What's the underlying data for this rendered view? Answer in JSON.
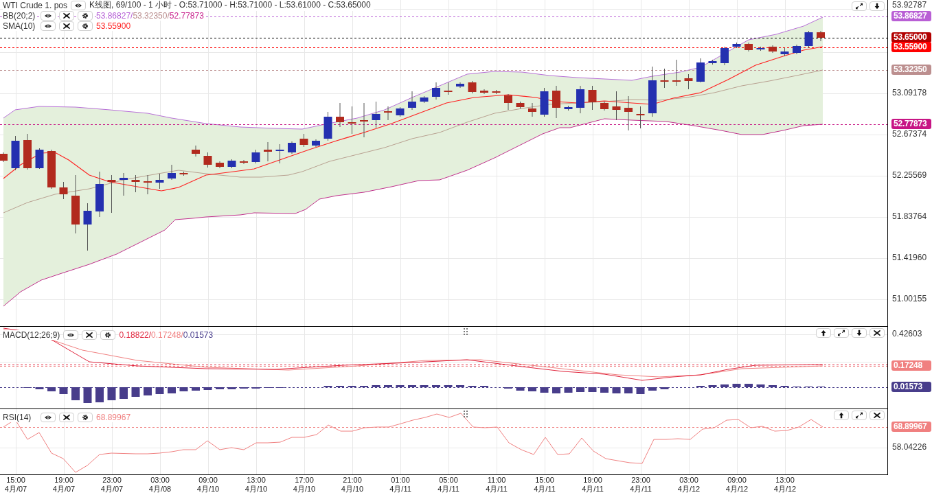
{
  "main_panel": {
    "title": "WTI Crude 1. pos",
    "summary": "K线图, 69/100 - 1 小时 - O:53.71000 - H:53.71000 - L:53.61000 - C:53.65000",
    "indicators": [
      {
        "name": "BB(20;2)",
        "values": [
          {
            "text": "53.86827/",
            "color": "#b660d6"
          },
          {
            "text": "53.32350/",
            "color": "#b88c8c"
          },
          {
            "text": "52.77873",
            "color": "#c8208c"
          }
        ]
      },
      {
        "name": "SMA(10)",
        "values": [
          {
            "text": "53.55900",
            "color": "#ff2222"
          }
        ]
      }
    ],
    "axis_labels": [
      "53.92787",
      "53.09178",
      "52.67374",
      "52.25569",
      "51.83764",
      "51.41960",
      "51.00155"
    ],
    "price_tags": [
      {
        "text": "53.86827",
        "color": "#b95fd5"
      },
      {
        "text": "53.65000",
        "color": "#b20000"
      },
      {
        "text": "53.55900",
        "color": "#ff0000"
      },
      {
        "text": "53.32350",
        "color": "#bc8f8f"
      },
      {
        "text": "52.77873",
        "color": "#c71585"
      }
    ]
  },
  "macd_panel": {
    "indicators": [
      {
        "name": "MACD(12;26;9)",
        "values": [
          {
            "text": "0.18822/",
            "color": "#e0243c"
          },
          {
            "text": "0.17248/",
            "color": "#f08080"
          },
          {
            "text": "0.01573",
            "color": "#483d8b"
          }
        ]
      }
    ],
    "axis_labels": [
      "0.42603"
    ],
    "price_tags": [
      {
        "text": "0.17248",
        "color": "#f08080"
      },
      {
        "text": "0.01573",
        "color": "#483d8b"
      }
    ]
  },
  "rsi_panel": {
    "indicators": [
      {
        "name": "RSI(14)",
        "values": [
          {
            "text": "68.89967",
            "color": "#f08080"
          }
        ]
      }
    ],
    "axis_labels": [
      "58.04226"
    ],
    "price_tags": [
      {
        "text": "68.89967",
        "color": "#f08080"
      }
    ]
  },
  "time_axis": [
    {
      "time": "15:00",
      "date": "4月/07"
    },
    {
      "time": "19:00",
      "date": "4月/07"
    },
    {
      "time": "23:00",
      "date": "4月/07"
    },
    {
      "time": "03:00",
      "date": "4月/08"
    },
    {
      "time": "09:00",
      "date": "4月/10"
    },
    {
      "time": "13:00",
      "date": "4月/10"
    },
    {
      "time": "17:00",
      "date": "4月/10"
    },
    {
      "time": "21:00",
      "date": "4月/10"
    },
    {
      "time": "01:00",
      "date": "4月/11"
    },
    {
      "time": "05:00",
      "date": "4月/11"
    },
    {
      "time": "11:00",
      "date": "4月/11"
    },
    {
      "time": "15:00",
      "date": "4月/11"
    },
    {
      "time": "19:00",
      "date": "4月/11"
    },
    {
      "time": "23:00",
      "date": "4月/11"
    },
    {
      "time": "03:00",
      "date": "4月/12"
    },
    {
      "time": "09:00",
      "date": "4月/12"
    },
    {
      "time": "13:00",
      "date": "4月/12"
    }
  ]
}
